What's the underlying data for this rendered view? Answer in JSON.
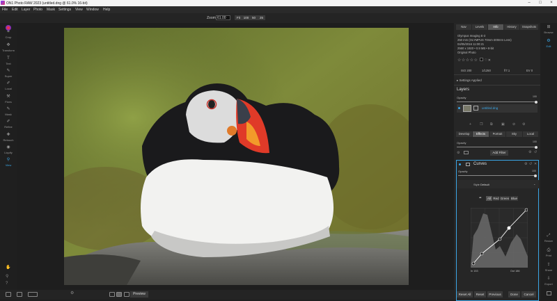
{
  "window": {
    "title": "ON1 Photo RAW 2023 (untitled.dng @ 61.0% 16-bit)"
  },
  "menu": [
    "File",
    "Edit",
    "Layer",
    "Photo",
    "Mask",
    "Settings",
    "View",
    "Window",
    "Help"
  ],
  "topbar": {
    "zoom_label": "Zoom:",
    "zoom_value": "61.00",
    "zoom_buttons": [
      "Fit",
      "100",
      "50",
      "25"
    ]
  },
  "left_tools": [
    {
      "label": "Crop",
      "icon": "crop-icon"
    },
    {
      "label": "Transform",
      "icon": "transform-icon"
    },
    {
      "label": "Text",
      "icon": "text-icon"
    },
    {
      "label": "Super",
      "icon": "super-brush-icon"
    },
    {
      "label": "Local",
      "icon": "local-brush-icon"
    },
    {
      "label": "Fixes",
      "icon": "fixes-icon"
    },
    {
      "label": "Mask",
      "icon": "mask-icon"
    },
    {
      "label": "Refine",
      "icon": "refine-icon"
    },
    {
      "label": "Retouch",
      "icon": "retouch-icon"
    },
    {
      "label": "Liquify",
      "icon": "liquify-icon"
    },
    {
      "label": "View",
      "icon": "view-icon"
    }
  ],
  "right_tabs": [
    "Nav",
    "Levels",
    "Info",
    "History",
    "Snapshots"
  ],
  "info": {
    "camera": "Olympus Imaging E-3",
    "lens": "250 mm (OLYMPUS 70mm-300mm Lens)",
    "date": "04/05/2016 11:00:21",
    "dims": "2560 x 1920 • 0.9 MB • 8-bit",
    "type": "Original Photo",
    "iso": "ISO 200",
    "shutter": "1/1250",
    "fstop": "f/7.1",
    "ev": "EV 0"
  },
  "settings_applied": "Settings Applied",
  "layers": {
    "title": "Layers",
    "opacity_label": "Opacity",
    "opacity_value": "100",
    "layer_name": "untitled.dng"
  },
  "module_tabs": [
    "Develop",
    "Effects",
    "Portrait",
    "Sky",
    "Local"
  ],
  "effects": {
    "opacity_label": "Opacity",
    "opacity_value": "100",
    "add_filter": "Add Filter"
  },
  "curves": {
    "title": "Curves",
    "opacity_label": "Opacity",
    "opacity_value": "100",
    "style_label": "Style",
    "style_value": "Default",
    "channels": [
      "All",
      "Red",
      "Green",
      "Blue"
    ],
    "in_label": "In",
    "in_value": "153",
    "out_label": "Out",
    "out_value": "186"
  },
  "right_bar": [
    {
      "label": "Browse",
      "icon": "browse-icon"
    },
    {
      "label": "Edit",
      "icon": "edit-icon"
    },
    {
      "label": "Resize",
      "icon": "resize-icon"
    },
    {
      "label": "Print",
      "icon": "print-icon"
    },
    {
      "label": "Share",
      "icon": "share-icon"
    },
    {
      "label": "Export",
      "icon": "export-icon"
    }
  ],
  "bottom": {
    "preview": "Preview"
  },
  "footer": [
    "Reset All",
    "Reset",
    "Previous",
    "Done",
    "Cancel"
  ],
  "colors": {
    "accent": "#3aa6e6"
  }
}
